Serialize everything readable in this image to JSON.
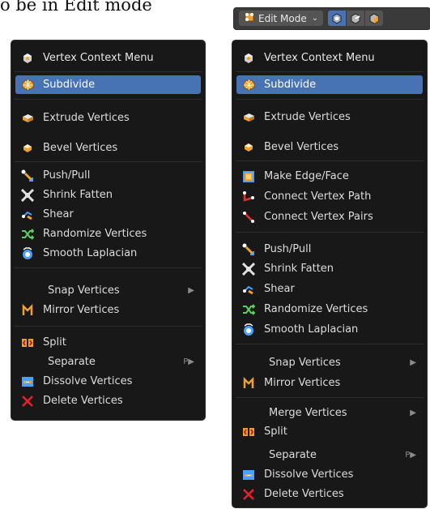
{
  "doc": {
    "text": "o be in Edit mode"
  },
  "header": {
    "mode_label": "Edit Mode"
  },
  "left_menu": {
    "title": "Vertex Context Menu",
    "items": [
      {
        "label": "Subdivide"
      },
      {
        "label": "Extrude Vertices"
      },
      {
        "label": "Bevel Vertices"
      },
      {
        "label": "Push/Pull"
      },
      {
        "label": "Shrink Fatten"
      },
      {
        "label": "Shear"
      },
      {
        "label": "Randomize Vertices"
      },
      {
        "label": "Smooth Laplacian"
      },
      {
        "label": "Snap Vertices"
      },
      {
        "label": "Mirror Vertices"
      },
      {
        "label": "Split"
      },
      {
        "label": "Separate",
        "shortcut": "P"
      },
      {
        "label": "Dissolve Vertices"
      },
      {
        "label": "Delete Vertices"
      }
    ]
  },
  "right_menu": {
    "title": "Vertex Context Menu",
    "items": [
      {
        "label": "Subdivide"
      },
      {
        "label": "Extrude Vertices"
      },
      {
        "label": "Bevel Vertices"
      },
      {
        "label": "Make Edge/Face"
      },
      {
        "label": "Connect Vertex Path"
      },
      {
        "label": "Connect Vertex Pairs"
      },
      {
        "label": "Push/Pull"
      },
      {
        "label": "Shrink Fatten"
      },
      {
        "label": "Shear"
      },
      {
        "label": "Randomize Vertices"
      },
      {
        "label": "Smooth Laplacian"
      },
      {
        "label": "Snap Vertices"
      },
      {
        "label": "Mirror Vertices"
      },
      {
        "label": "Merge Vertices"
      },
      {
        "label": "Split"
      },
      {
        "label": "Separate",
        "shortcut": "P"
      },
      {
        "label": "Dissolve Vertices"
      },
      {
        "label": "Delete Vertices"
      }
    ]
  },
  "colors": {
    "menu_bg": "#181818",
    "highlight": "#4772b3",
    "text": "#dcdcdc"
  }
}
